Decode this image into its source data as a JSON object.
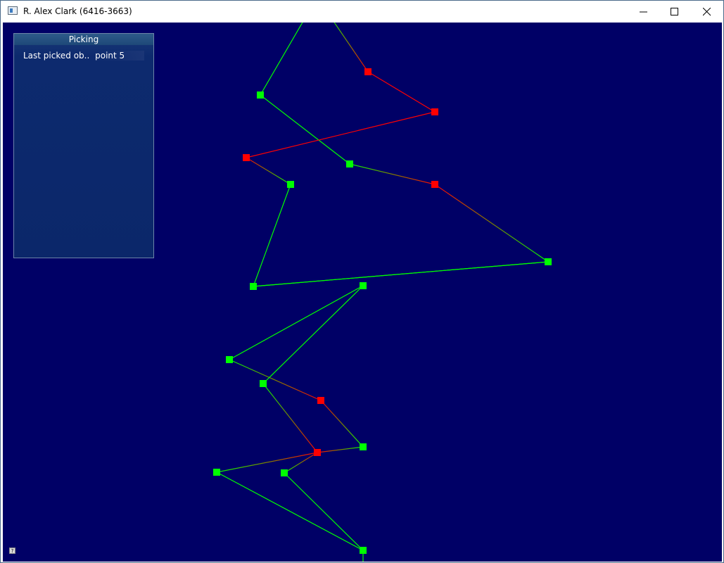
{
  "window": {
    "title": "R. Alex Clark (6416-3663)"
  },
  "picking_panel": {
    "title": "Picking",
    "last_picked_label": "Last picked ob..",
    "last_picked_value": "point 5"
  },
  "icons": {
    "app": "app-window-icon",
    "minimize": "minimize-icon",
    "maximize": "maximize-icon",
    "close": "close-icon",
    "help": "help-icon"
  },
  "colors": {
    "background": "#000066",
    "green_point": "#00ff00",
    "red_point": "#ff0000"
  },
  "scene": {
    "points": [
      {
        "state": "unpicked"
      },
      {
        "state": "unpicked"
      },
      {
        "state": "unpicked"
      },
      {
        "state": "picked"
      },
      {
        "state": "unpicked"
      },
      {
        "state": "unpicked"
      },
      {
        "state": "unpicked"
      },
      {
        "state": "picked"
      },
      {
        "state": "picked"
      },
      {
        "state": "picked"
      },
      {
        "state": "unpicked"
      },
      {
        "state": "unpicked"
      },
      {
        "state": "unpicked"
      },
      {
        "state": "picked"
      },
      {
        "state": "unpicked"
      },
      {
        "state": "unpicked"
      },
      {
        "state": "unpicked"
      },
      {
        "state": "picked"
      }
    ]
  }
}
